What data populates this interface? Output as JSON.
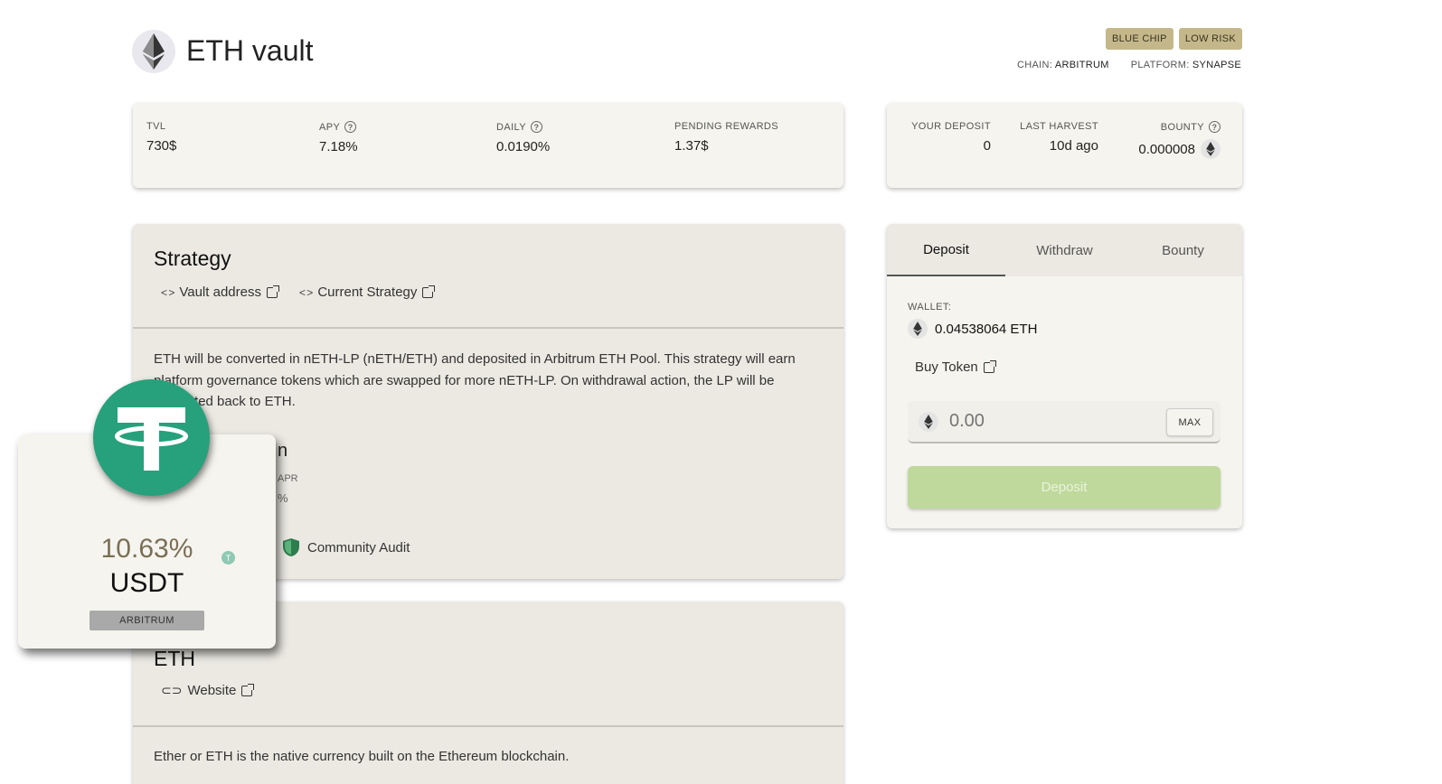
{
  "header": {
    "title": "ETH vault",
    "badges": [
      "BLUE CHIP",
      "LOW RISK"
    ],
    "chain_label": "CHAIN:",
    "chain_value": "ARBITRUM",
    "platform_label": "PLATFORM:",
    "platform_value": "SYNAPSE"
  },
  "stats": {
    "tvl_label": "TVL",
    "tvl_value": "730$",
    "apy_label": "APY",
    "apy_value": "7.18%",
    "daily_label": "DAILY",
    "daily_value": "0.0190%",
    "pending_label": "PENDING REWARDS",
    "pending_value": "1.37$"
  },
  "user_stats": {
    "deposit_label": "YOUR DEPOSIT",
    "deposit_value": "0",
    "harvest_label": "LAST HARVEST",
    "harvest_value": "10d ago",
    "bounty_label": "BOUNTY",
    "bounty_value": "0.000008"
  },
  "strategy": {
    "title": "Strategy",
    "vault_address_link": "Vault address",
    "current_strategy_link": "Current Strategy",
    "description": "ETH will be converted in nETH-LP (nETH/ETH) and deposited in Arbitrum ETH Pool. This strategy will earn platform governance tokens which are swapped for more nETH-LP. On withdrawal action, the LP will be converted back to ETH.",
    "partial_heading": "n",
    "apr_label": "APR",
    "partial_pct": "%",
    "audit_label": "Community Audit"
  },
  "token": {
    "title": "ETH",
    "website_link": "Website",
    "description": "Ether or ETH is the native currency built on the Ethereum blockchain."
  },
  "action": {
    "tabs": [
      "Deposit",
      "Withdraw",
      "Bounty"
    ],
    "wallet_label": "WALLET:",
    "wallet_balance": "0.04538064 ETH",
    "buy_token": "Buy Token",
    "amount_placeholder": "0.00",
    "max_label": "MAX",
    "deposit_button": "Deposit"
  },
  "overlay": {
    "rate": "10.63%",
    "symbol": "USDT",
    "chain": "ARBITRUM",
    "mini_icon_letter": "T"
  },
  "colors": {
    "badge": "#c4b88a",
    "tether_green": "#26a17b",
    "deposit_button": "#bfd99c",
    "card_bg": "#f5f4ee",
    "panel_bg": "#ebe9e2"
  }
}
